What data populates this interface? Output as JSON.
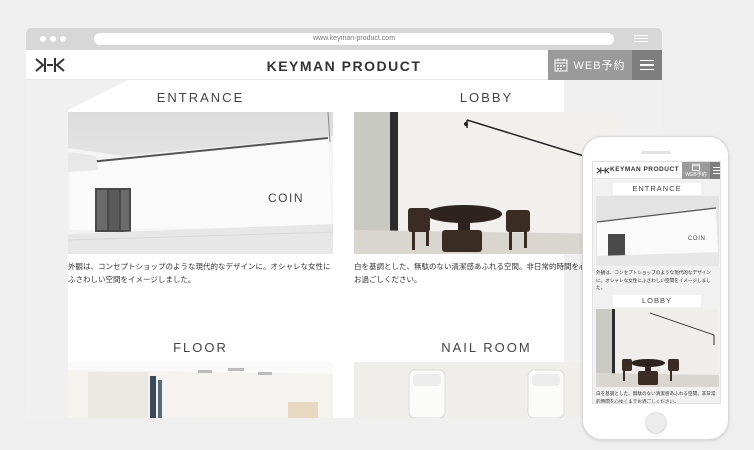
{
  "browser": {
    "url": "www.keyman-product.com"
  },
  "site": {
    "title": "KEYMAN PRODUCT",
    "web_reserve_label": "WEB予約"
  },
  "sections": [
    {
      "heading": "ENTRANCE",
      "caption": "外観は、コンセプトショップのような現代的なデザインに。オシャレな女性にふさわしい空間をイメージしました。",
      "sign": "COIN"
    },
    {
      "heading": "LOBBY",
      "caption": "白を基調とした、無駄のない清潔感あふれる空間。非日常的時間を心ゆくまでお過ごしください。"
    },
    {
      "heading": "FLOOR"
    },
    {
      "heading": "NAIL ROOM"
    }
  ],
  "phone": {
    "title": "KEYMAN PRODUCT",
    "web_reserve_label": "WEB予約",
    "sections": [
      {
        "heading": "ENTRANCE",
        "caption": "外観は、コンセプトショップのような現代的なデザインに。オシャレな女性にふさわしい空間をイメージしました。",
        "sign": "COIN"
      },
      {
        "heading": "LOBBY",
        "caption": "白を基調とした、無駄のない清潔感あふれる空間。非日常的時間を心ゆくまでお過ごしください。"
      }
    ]
  },
  "colors": {
    "page_bg": "#efefef",
    "accent_gray": "#9a9a9a",
    "menu_gray": "#7e7e7e"
  }
}
